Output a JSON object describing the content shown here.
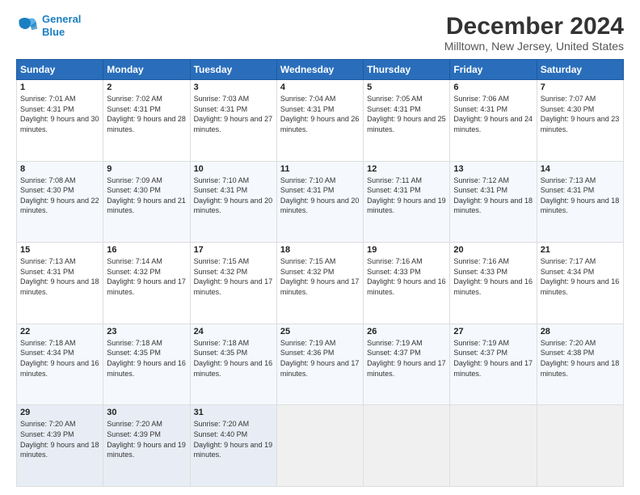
{
  "logo": {
    "line1": "General",
    "line2": "Blue"
  },
  "title": "December 2024",
  "subtitle": "Milltown, New Jersey, United States",
  "days_of_week": [
    "Sunday",
    "Monday",
    "Tuesday",
    "Wednesday",
    "Thursday",
    "Friday",
    "Saturday"
  ],
  "weeks": [
    [
      {
        "day": "1",
        "sunrise": "7:01 AM",
        "sunset": "4:31 PM",
        "daylight": "9 hours and 30 minutes."
      },
      {
        "day": "2",
        "sunrise": "7:02 AM",
        "sunset": "4:31 PM",
        "daylight": "9 hours and 28 minutes."
      },
      {
        "day": "3",
        "sunrise": "7:03 AM",
        "sunset": "4:31 PM",
        "daylight": "9 hours and 27 minutes."
      },
      {
        "day": "4",
        "sunrise": "7:04 AM",
        "sunset": "4:31 PM",
        "daylight": "9 hours and 26 minutes."
      },
      {
        "day": "5",
        "sunrise": "7:05 AM",
        "sunset": "4:31 PM",
        "daylight": "9 hours and 25 minutes."
      },
      {
        "day": "6",
        "sunrise": "7:06 AM",
        "sunset": "4:31 PM",
        "daylight": "9 hours and 24 minutes."
      },
      {
        "day": "7",
        "sunrise": "7:07 AM",
        "sunset": "4:30 PM",
        "daylight": "9 hours and 23 minutes."
      }
    ],
    [
      {
        "day": "8",
        "sunrise": "7:08 AM",
        "sunset": "4:30 PM",
        "daylight": "9 hours and 22 minutes."
      },
      {
        "day": "9",
        "sunrise": "7:09 AM",
        "sunset": "4:30 PM",
        "daylight": "9 hours and 21 minutes."
      },
      {
        "day": "10",
        "sunrise": "7:10 AM",
        "sunset": "4:31 PM",
        "daylight": "9 hours and 20 minutes."
      },
      {
        "day": "11",
        "sunrise": "7:10 AM",
        "sunset": "4:31 PM",
        "daylight": "9 hours and 20 minutes."
      },
      {
        "day": "12",
        "sunrise": "7:11 AM",
        "sunset": "4:31 PM",
        "daylight": "9 hours and 19 minutes."
      },
      {
        "day": "13",
        "sunrise": "7:12 AM",
        "sunset": "4:31 PM",
        "daylight": "9 hours and 18 minutes."
      },
      {
        "day": "14",
        "sunrise": "7:13 AM",
        "sunset": "4:31 PM",
        "daylight": "9 hours and 18 minutes."
      }
    ],
    [
      {
        "day": "15",
        "sunrise": "7:13 AM",
        "sunset": "4:31 PM",
        "daylight": "9 hours and 18 minutes."
      },
      {
        "day": "16",
        "sunrise": "7:14 AM",
        "sunset": "4:32 PM",
        "daylight": "9 hours and 17 minutes."
      },
      {
        "day": "17",
        "sunrise": "7:15 AM",
        "sunset": "4:32 PM",
        "daylight": "9 hours and 17 minutes."
      },
      {
        "day": "18",
        "sunrise": "7:15 AM",
        "sunset": "4:32 PM",
        "daylight": "9 hours and 17 minutes."
      },
      {
        "day": "19",
        "sunrise": "7:16 AM",
        "sunset": "4:33 PM",
        "daylight": "9 hours and 16 minutes."
      },
      {
        "day": "20",
        "sunrise": "7:16 AM",
        "sunset": "4:33 PM",
        "daylight": "9 hours and 16 minutes."
      },
      {
        "day": "21",
        "sunrise": "7:17 AM",
        "sunset": "4:34 PM",
        "daylight": "9 hours and 16 minutes."
      }
    ],
    [
      {
        "day": "22",
        "sunrise": "7:18 AM",
        "sunset": "4:34 PM",
        "daylight": "9 hours and 16 minutes."
      },
      {
        "day": "23",
        "sunrise": "7:18 AM",
        "sunset": "4:35 PM",
        "daylight": "9 hours and 16 minutes."
      },
      {
        "day": "24",
        "sunrise": "7:18 AM",
        "sunset": "4:35 PM",
        "daylight": "9 hours and 16 minutes."
      },
      {
        "day": "25",
        "sunrise": "7:19 AM",
        "sunset": "4:36 PM",
        "daylight": "9 hours and 17 minutes."
      },
      {
        "day": "26",
        "sunrise": "7:19 AM",
        "sunset": "4:37 PM",
        "daylight": "9 hours and 17 minutes."
      },
      {
        "day": "27",
        "sunrise": "7:19 AM",
        "sunset": "4:37 PM",
        "daylight": "9 hours and 17 minutes."
      },
      {
        "day": "28",
        "sunrise": "7:20 AM",
        "sunset": "4:38 PM",
        "daylight": "9 hours and 18 minutes."
      }
    ],
    [
      {
        "day": "29",
        "sunrise": "7:20 AM",
        "sunset": "4:39 PM",
        "daylight": "9 hours and 18 minutes."
      },
      {
        "day": "30",
        "sunrise": "7:20 AM",
        "sunset": "4:39 PM",
        "daylight": "9 hours and 19 minutes."
      },
      {
        "day": "31",
        "sunrise": "7:20 AM",
        "sunset": "4:40 PM",
        "daylight": "9 hours and 19 minutes."
      },
      null,
      null,
      null,
      null
    ]
  ],
  "labels": {
    "sunrise": "Sunrise:",
    "sunset": "Sunset:",
    "daylight": "Daylight:"
  }
}
